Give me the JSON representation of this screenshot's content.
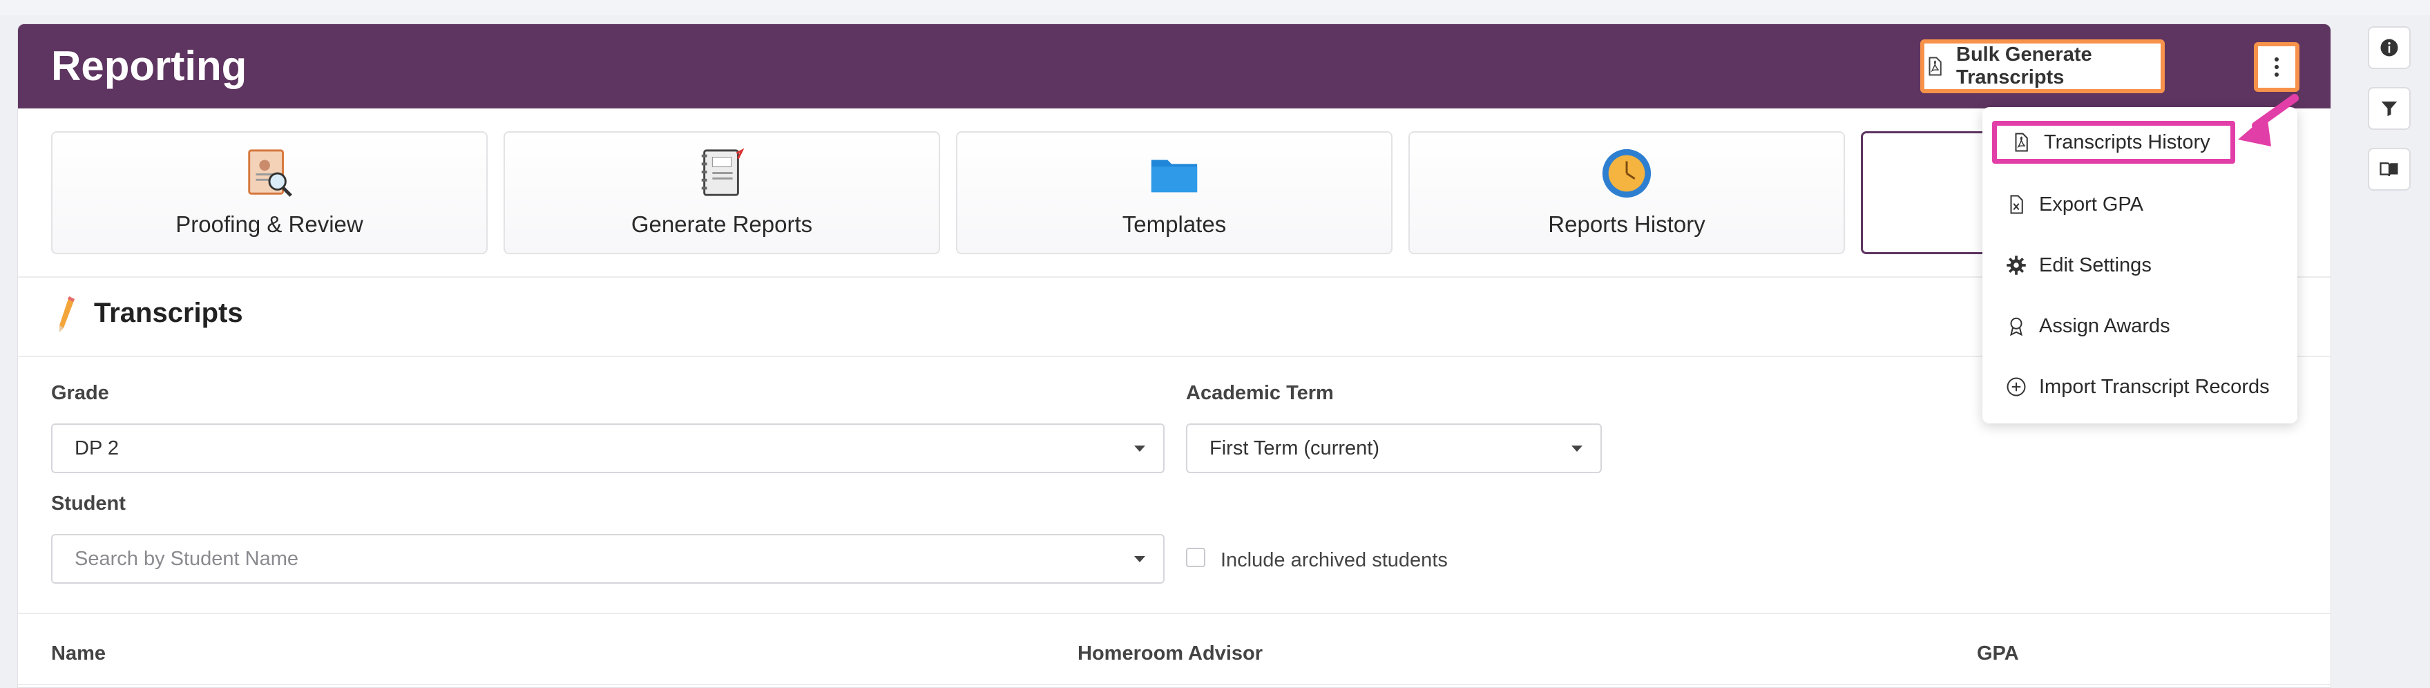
{
  "header": {
    "title": "Reporting",
    "bulk_button_label": "Bulk Generate Transcripts"
  },
  "tiles": [
    {
      "label": "Proofing & Review",
      "icon": "proofing-icon"
    },
    {
      "label": "Generate Reports",
      "icon": "report-cards-icon"
    },
    {
      "label": "Templates",
      "icon": "folder-icon"
    },
    {
      "label": "Reports History",
      "icon": "clock-icon"
    },
    {
      "label": "",
      "icon": ""
    }
  ],
  "section": {
    "title": "Transcripts"
  },
  "form": {
    "grade_label": "Grade",
    "grade_value": "DP 2",
    "term_label": "Academic Term",
    "term_value": "First Term (current)",
    "student_label": "Student",
    "student_placeholder": "Search by Student Name",
    "archived_label": "Include archived students"
  },
  "table": {
    "columns": [
      "Name",
      "Homeroom Advisor",
      "GPA"
    ]
  },
  "menu": {
    "items": [
      {
        "label": "Transcripts History",
        "icon": "pdf-file-icon"
      },
      {
        "label": "Export GPA",
        "icon": "excel-file-icon"
      },
      {
        "label": "Edit Settings",
        "icon": "gear-icon"
      },
      {
        "label": "Assign Awards",
        "icon": "award-icon"
      },
      {
        "label": "Import Transcript Records",
        "icon": "plus-circle-icon"
      }
    ]
  },
  "colors": {
    "header": "#5e3460",
    "highlight_orange": "#f6924a",
    "highlight_pink": "#e23ea8"
  }
}
